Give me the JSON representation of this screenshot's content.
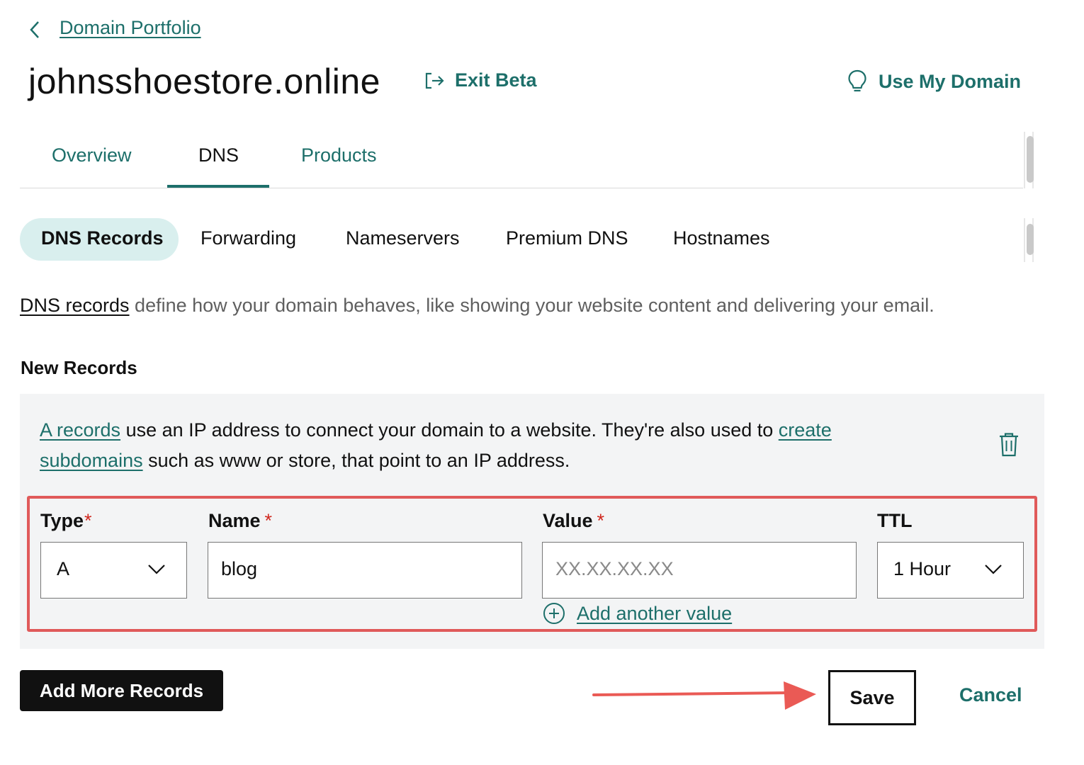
{
  "breadcrumb": {
    "back_icon": "chevron-left-icon",
    "label": "Domain Portfolio"
  },
  "header": {
    "domain": "johnsshoestore.online",
    "exit_beta": "Exit Beta",
    "use_my_domain": "Use My Domain"
  },
  "tabs": [
    {
      "label": "Overview",
      "active": false
    },
    {
      "label": "DNS",
      "active": true
    },
    {
      "label": "Products",
      "active": false
    }
  ],
  "subtabs": [
    {
      "label": "DNS Records",
      "active": true
    },
    {
      "label": "Forwarding",
      "active": false
    },
    {
      "label": "Nameservers",
      "active": false
    },
    {
      "label": "Premium DNS",
      "active": false
    },
    {
      "label": "Hostnames",
      "active": false
    }
  ],
  "description": {
    "link": "DNS records",
    "rest": " define how your domain behaves, like showing your website content and delivering your email."
  },
  "section_title": "New Records",
  "card": {
    "link1": "A records",
    "text1": " use an IP address to connect your domain to a website. They're also used to ",
    "link2": "create subdomains",
    "text2": " such as www or store, that point to an IP address.",
    "delete_icon": "trash-icon"
  },
  "form": {
    "type": {
      "label": "Type",
      "required": "*",
      "value": "A"
    },
    "name": {
      "label": "Name",
      "required": "*",
      "value": "blog"
    },
    "value": {
      "label": "Value",
      "required": "*",
      "placeholder": "XX.XX.XX.XX"
    },
    "ttl": {
      "label": "TTL",
      "value": "1 Hour"
    },
    "add_value": "Add another value"
  },
  "buttons": {
    "add_more": "Add More Records",
    "save": "Save",
    "cancel": "Cancel"
  },
  "colors": {
    "accent": "#1d6f6a",
    "highlight": "#e05a5a",
    "pill": "#d9efee",
    "card": "#f3f4f5"
  }
}
